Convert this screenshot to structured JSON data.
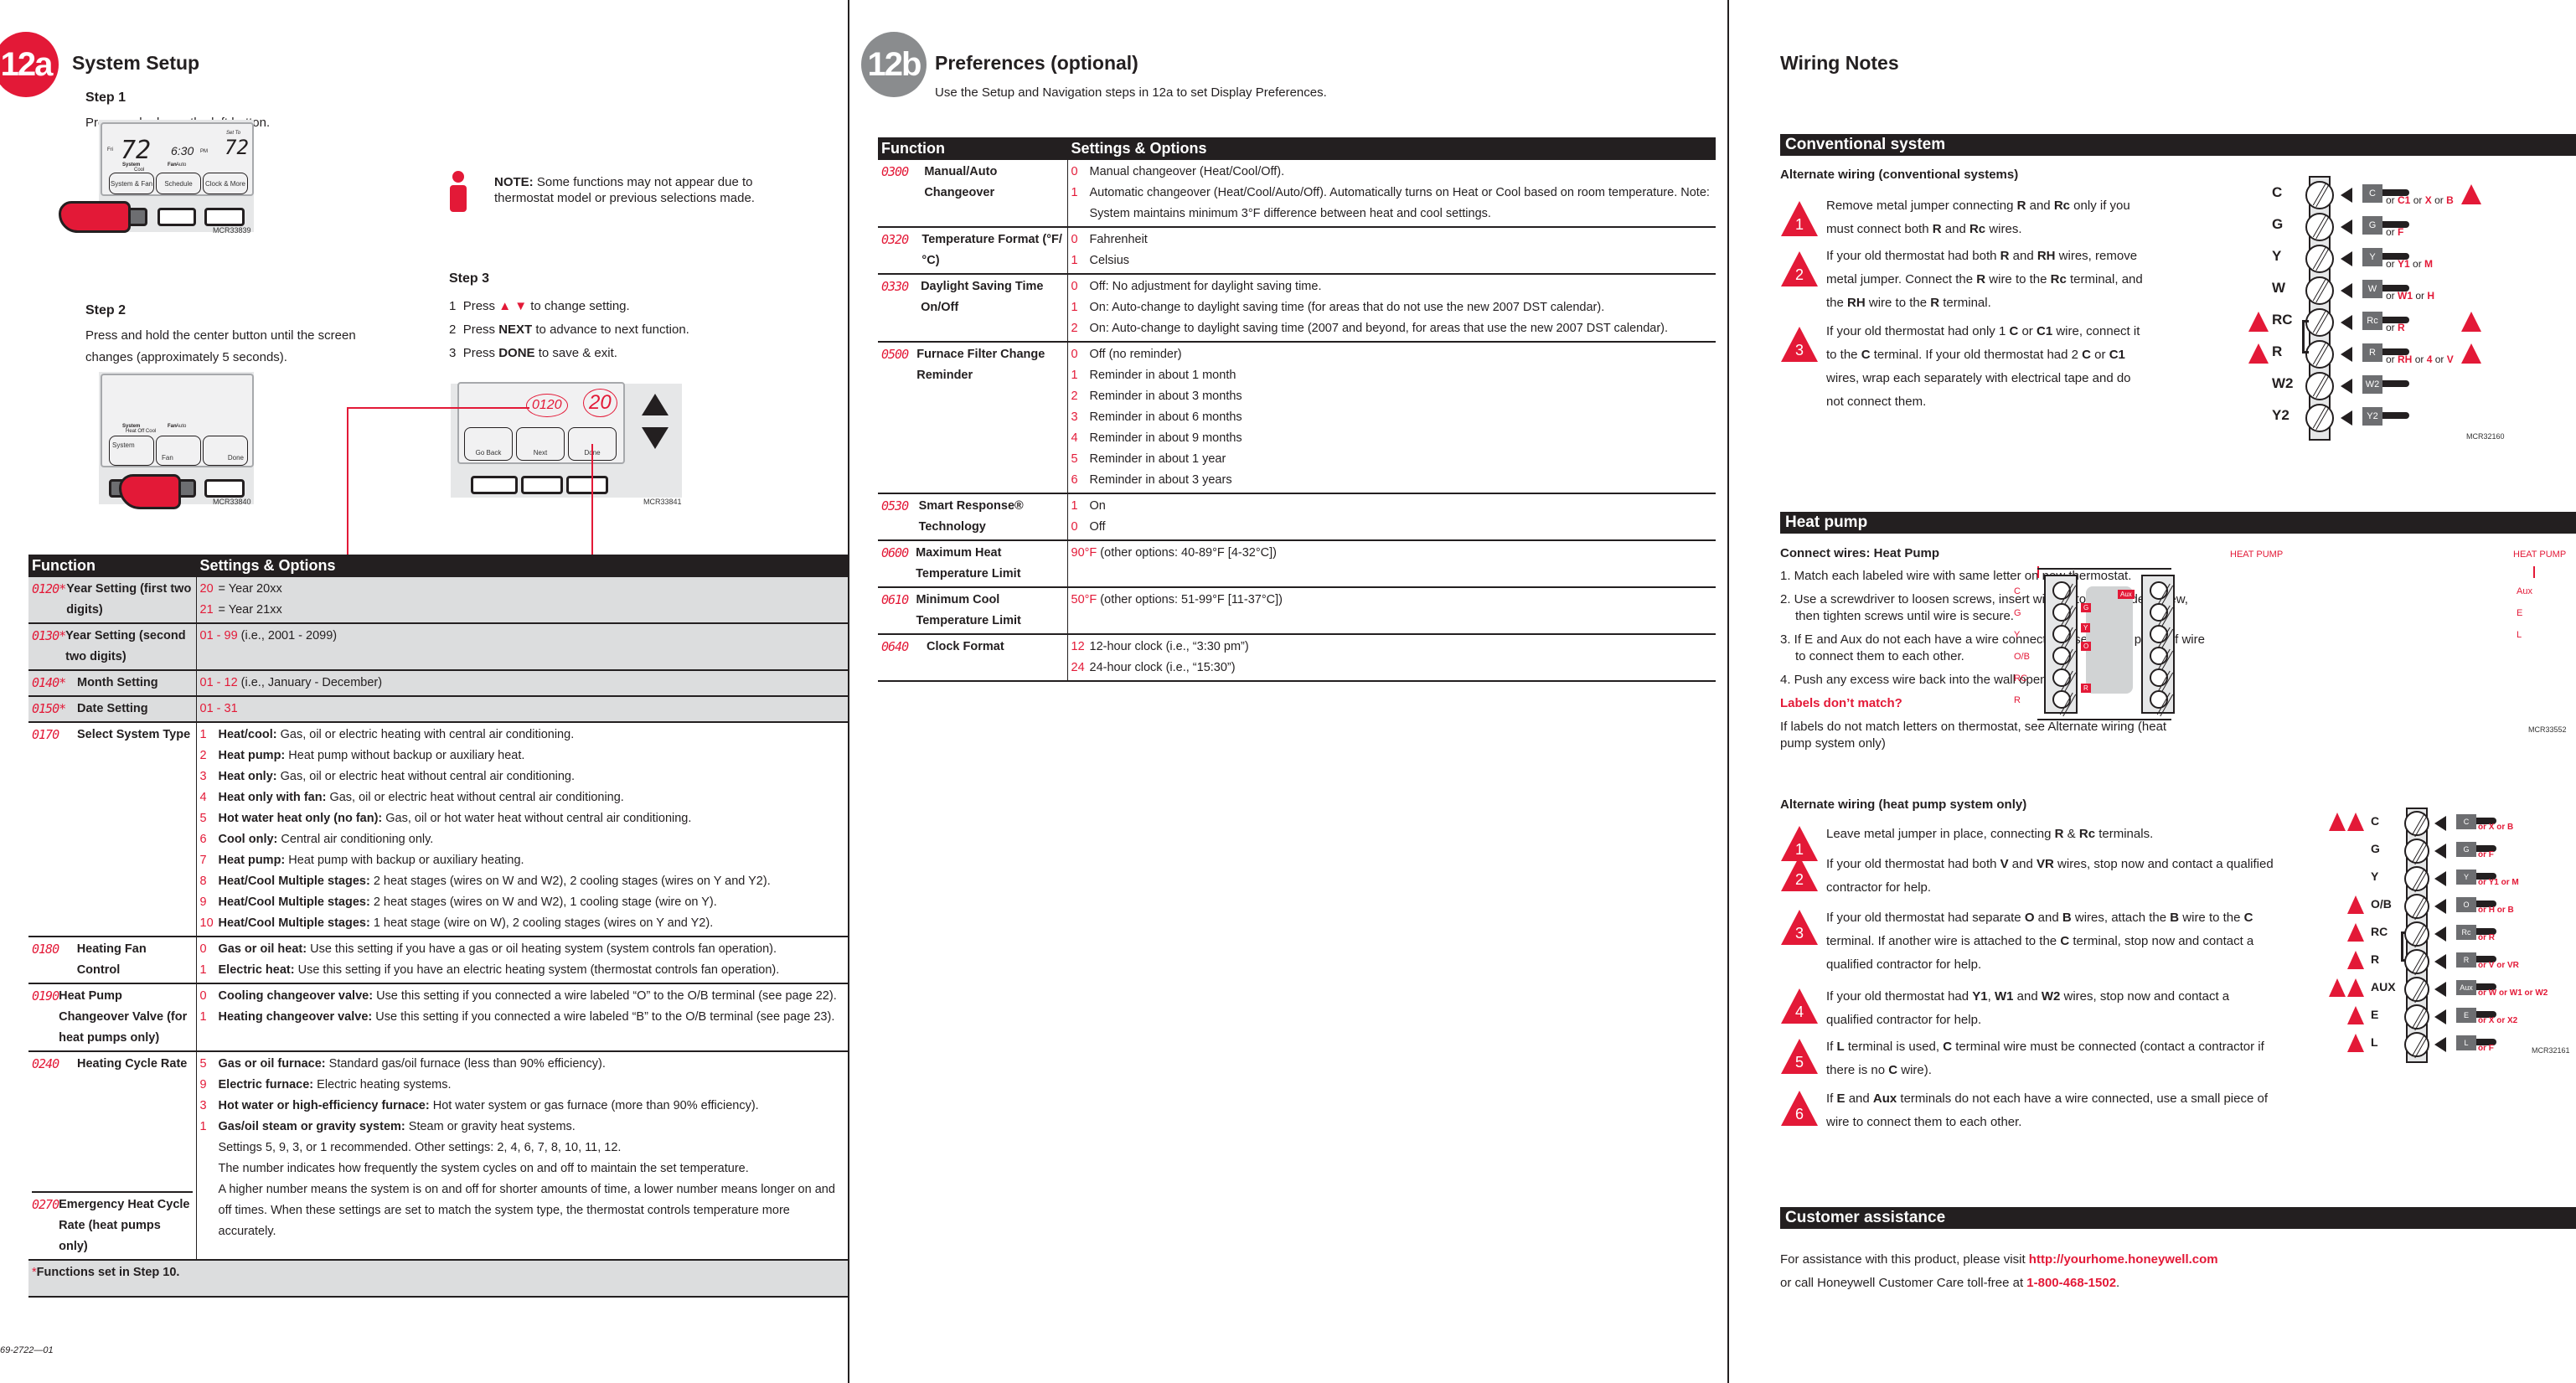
{
  "page_12a": {
    "badge": "12a",
    "title": "System Setup",
    "step1": {
      "heading": "Step 1",
      "text": "Press and release the left button."
    },
    "fig1": {
      "day": "Fri",
      "indoor_temp": "72",
      "time": "6:30",
      "ampm": "PM",
      "set_to_label": "Set To",
      "set_temp": "72",
      "system_label": "System",
      "system_mode": "Cool",
      "fan_label": "Fan",
      "fan_mode": "Auto",
      "buttons": [
        "System & Fan",
        "Schedule",
        "Clock & More"
      ],
      "code": "MCR33839"
    },
    "step2": {
      "heading": "Step 2",
      "text": "Press and hold the center button until the screen changes (approximately 5 seconds)."
    },
    "fig2": {
      "system_label": "System",
      "system_modes": "Heat Off Cool",
      "fan_label": "Fan",
      "fan_mode": "Auto",
      "buttons": [
        "System",
        "Fan",
        "Done"
      ],
      "code": "MCR33840"
    },
    "note": {
      "label": "NOTE:",
      "text": "Some functions may not appear due to thermostat model or previous selections made."
    },
    "step3": {
      "heading": "Step 3",
      "items": [
        {
          "num": "1",
          "pre": "Press",
          "bold": "▲ ▼",
          "post": "to change setting."
        },
        {
          "num": "2",
          "pre": "Press",
          "bold": "NEXT",
          "post": "to advance to next function."
        },
        {
          "num": "3",
          "pre": "Press",
          "bold": "DONE",
          "post": "to save & exit."
        }
      ]
    },
    "fig3": {
      "function_code": "0120",
      "value": "20",
      "buttons": [
        "Go Back",
        "Next",
        "Done"
      ],
      "code": "MCR33841"
    },
    "table": {
      "headers": [
        "Function",
        "Settings & Options"
      ],
      "rows": [
        {
          "code": "0120*",
          "name": "Year Setting (first two digits)",
          "grey": true,
          "options": [
            {
              "n": "20",
              "t": "= Year 20xx"
            },
            {
              "n": "21",
              "t": "= Year 21xx"
            }
          ]
        },
        {
          "code": "0130*",
          "name": "Year Setting (second two digits)",
          "grey": true,
          "options": [
            {
              "n": "01 - 99",
              "t": "(i.e., 2001 - 2099)"
            }
          ]
        },
        {
          "code": "0140*",
          "name": "Month Setting",
          "grey": true,
          "options": [
            {
              "n": "01 - 12",
              "t": "(i.e., January - December)"
            }
          ]
        },
        {
          "code": "0150*",
          "name": "Date Setting",
          "grey": true,
          "options": [
            {
              "n": "01 - 31",
              "t": ""
            }
          ]
        },
        {
          "code": "0170",
          "name": "Select System Type",
          "grey": false,
          "options": [
            {
              "n": "1",
              "b": "Heat/cool:",
              "t": "Gas, oil or electric heating with central air conditioning."
            },
            {
              "n": "2",
              "b": "Heat pump:",
              "t": "Heat pump without backup or auxiliary heat."
            },
            {
              "n": "3",
              "b": "Heat only:",
              "t": "Gas, oil or electric heat without central air conditioning."
            },
            {
              "n": "4",
              "b": "Heat only with fan:",
              "t": "Gas, oil or electric heat without central air conditioning."
            },
            {
              "n": "5",
              "b": "Hot water heat only (no fan):",
              "t": "Gas, oil or hot water heat without central air conditioning."
            },
            {
              "n": "6",
              "b": "Cool only:",
              "t": "Central air conditioning only."
            },
            {
              "n": "7",
              "b": "Heat pump:",
              "t": "Heat pump with backup or auxiliary heating."
            },
            {
              "n": "8",
              "b": "Heat/Cool Multiple stages:",
              "t": "2 heat stages (wires on W and W2), 2 cooling stages (wires on Y and Y2)."
            },
            {
              "n": "9",
              "b": "Heat/Cool Multiple stages:",
              "t": "2 heat stages (wires on W and W2), 1 cooling stage (wire on Y)."
            },
            {
              "n": "10",
              "b": "Heat/Cool Multiple stages:",
              "t": "1 heat stage (wire on W), 2 cooling stages (wires on Y and Y2)."
            }
          ]
        },
        {
          "code": "0180",
          "name": "Heating Fan Control",
          "grey": false,
          "options": [
            {
              "n": "0",
              "b": "Gas or oil heat:",
              "t": "Use this setting if you have a gas or oil heating system (system controls fan operation)."
            },
            {
              "n": "1",
              "b": "Electric heat:",
              "t": "Use this setting if you have an electric heating system (thermostat controls fan operation)."
            }
          ]
        },
        {
          "code": "0190",
          "name": "Heat Pump Changeover Valve (for heat pumps only)",
          "grey": false,
          "options": [
            {
              "n": "0",
              "b": "Cooling changeover valve:",
              "t": "Use this setting if you connected a wire labeled “O” to the O/B terminal (see page 22)."
            },
            {
              "n": "1",
              "b": "Heating changeover valve:",
              "t": "Use this setting if you connected a wire labeled “B” to the O/B terminal (see page 23)."
            }
          ]
        }
      ],
      "cycle": {
        "codes": [
          {
            "code": "0240",
            "name": "Heating Cycle Rate"
          },
          {
            "code": "0270",
            "name": "Emergency Heat Cycle Rate (heat pumps only)"
          }
        ],
        "options": [
          {
            "n": "5",
            "b": "Gas or oil furnace:",
            "t": "Standard gas/oil furnace (less than 90% efficiency)."
          },
          {
            "n": "9",
            "b": "Electric furnace:",
            "t": "Electric heating systems."
          },
          {
            "n": "3",
            "b": "Hot water or high-efficiency furnace:",
            "t": "Hot water system or gas furnace (more than 90% efficiency)."
          },
          {
            "n": "1",
            "b": "Gas/oil steam or gravity system:",
            "t": "Steam or gravity heat systems."
          }
        ],
        "notes": [
          "Settings 5, 9, 3, or 1 recommended. Other settings: 2, 4, 6, 7, 8, 10, 11, 12.",
          "The number indicates how frequently the system cycles on and off to maintain the set temperature.",
          "A higher number means the system is on and off for shorter amounts of time, a lower number means longer on and off times. When these settings are set to match the system type, the thermostat controls temperature more accurately."
        ]
      },
      "footnote_star": "*",
      "footnote": "Functions set in Step 10."
    },
    "doc_number": "69-2722—01"
  },
  "page_12b": {
    "badge": "12b",
    "title": "Preferences (optional)",
    "intro": "Use the Setup and Navigation steps in 12a to set Display Preferences.",
    "table": {
      "headers": [
        "Function",
        "Settings & Options"
      ],
      "rows": [
        {
          "code": "0300",
          "name": "Manual/Auto Changeover",
          "options": [
            {
              "n": "0",
              "t": "Manual changeover (Heat/Cool/Off)."
            },
            {
              "n": "1",
              "t": "Automatic changeover (Heat/Cool/Auto/Off). Automatically turns on Heat or Cool based on room temperature. Note: System maintains minimum 3°F difference between heat and cool settings."
            }
          ]
        },
        {
          "code": "0320",
          "name": "Temperature Format (°F/°C)",
          "options": [
            {
              "n": "0",
              "t": "Fahrenheit"
            },
            {
              "n": "1",
              "t": "Celsius"
            }
          ]
        },
        {
          "code": "0330",
          "name": "Daylight Saving Time On/Off",
          "options": [
            {
              "n": "0",
              "t": "Off: No adjustment for daylight saving time."
            },
            {
              "n": "1",
              "t": "On: Auto-change to daylight saving time (for areas that do not use the new 2007 DST calendar)."
            },
            {
              "n": "2",
              "t": "On: Auto-change to daylight saving time (2007 and beyond, for areas that use the new 2007 DST calendar)."
            }
          ]
        },
        {
          "code": "0500",
          "name": "Furnace Filter Change Reminder",
          "options": [
            {
              "n": "0",
              "t": "Off (no reminder)"
            },
            {
              "n": "1",
              "t": "Reminder in about 1 month"
            },
            {
              "n": "2",
              "t": "Reminder in about 3 months"
            },
            {
              "n": "3",
              "t": "Reminder in about 6 months"
            },
            {
              "n": "4",
              "t": "Reminder in about 9 months"
            },
            {
              "n": "5",
              "t": "Reminder in about 1 year"
            },
            {
              "n": "6",
              "t": "Reminder in about 3 years"
            }
          ]
        },
        {
          "code": "0530",
          "name": "Smart Response® Technology",
          "options": [
            {
              "n": "1",
              "t": "On"
            },
            {
              "n": "0",
              "t": "Off"
            }
          ]
        },
        {
          "code": "0600",
          "name": "Maximum Heat Temperature Limit",
          "options": [
            {
              "n": "90°F",
              "t": "(other options: 40-89°F [4-32°C])"
            }
          ]
        },
        {
          "code": "0610",
          "name": "Minimum Cool Temperature Limit",
          "options": [
            {
              "n": "50°F",
              "t": "(other options: 51-99°F [11-37°C])"
            }
          ]
        },
        {
          "code": "0640",
          "name": "Clock Format",
          "options": [
            {
              "n": "12",
              "t": "12-hour clock (i.e., “3:30 pm”)"
            },
            {
              "n": "24",
              "t": "24-hour clock (i.e., “15:30”)"
            }
          ]
        }
      ]
    }
  },
  "wiring": {
    "title": "Wiring Notes",
    "conventional": {
      "bar": "Conventional system",
      "subtitle": "Alternate wiring (conventional systems)",
      "notes": [
        {
          "num": "1",
          "text": "Remove metal jumper connecting R and Rc only if you must connect both R and Rc wires."
        },
        {
          "num": "2",
          "text": "If your old thermostat had both R and RH wires, remove metal jumper. Connect the R wire to the Rc terminal, and the RH wire to the R terminal."
        },
        {
          "num": "3",
          "text": "If your old thermostat had only 1 C or C1 wire, connect it to the C terminal. If your old thermostat had 2 C or C1 wires, wrap each separately with electrical tape and do not connect them."
        }
      ],
      "terminals": [
        {
          "label": "C",
          "tag": "C",
          "alt": "or C1 or X or B",
          "warn_right": "3"
        },
        {
          "label": "G",
          "tag": "G",
          "alt": "or F"
        },
        {
          "label": "Y",
          "tag": "Y",
          "alt": "or Y1 or M"
        },
        {
          "label": "W",
          "tag": "W",
          "alt": "or W1 or H"
        },
        {
          "label": "RC",
          "tag": "Rc",
          "alt": "or R",
          "warn_left": "1",
          "warn_right": "2"
        },
        {
          "label": "R",
          "tag": "R",
          "alt": "or RH or 4 or V",
          "warn_left": "1",
          "warn_right": "2"
        },
        {
          "label": "W2",
          "tag": "W2",
          "alt": ""
        },
        {
          "label": "Y2",
          "tag": "Y2",
          "alt": ""
        }
      ],
      "code": "MCR32160"
    },
    "heat_pump": {
      "bar": "Heat pump",
      "subtitle": "Connect wires: Heat Pump",
      "steps": [
        "1. Match each labeled wire with same letter on new thermostat.",
        "2. Use a screwdriver to loosen screws, insert wires into hole under screw, then tighten screws until wire is secure.",
        "3. If E and Aux do not each have a wire connected, use a small piece of wire to connect them to each other.",
        "4. Push any excess wire back into the wall opening."
      ],
      "labels_heading": "Labels don’t match?",
      "labels_text": "If labels do not match letters on thermostat, see Alternate wiring (heat pump system only)",
      "fig": {
        "left_title": "HEAT PUMP",
        "right_title": "HEAT PUMP",
        "left_terminals": [
          "C",
          "G",
          "Y",
          "O/B",
          "RC",
          "R"
        ],
        "right_terminals": [
          "Aux",
          "E",
          "L"
        ],
        "wire_tags": [
          "G",
          "Y",
          "O",
          "R",
          "Aux"
        ],
        "code": "MCR33552"
      }
    },
    "alt_heat_pump": {
      "subtitle": "Alternate wiring (heat pump system only)",
      "notes": [
        {
          "num": "1",
          "text": "Leave metal jumper in place, connecting R & Rc terminals."
        },
        {
          "num": "2",
          "text": "If your old thermostat had both V and VR wires, stop now and contact a qualified contractor for help."
        },
        {
          "num": "3",
          "text": "If your old thermostat had separate O and B wires, attach the B wire to the C terminal. If another wire is attached to the C terminal, stop now and contact a qualified contractor for help."
        },
        {
          "num": "4",
          "text": "If your old thermostat had Y1, W1 and W2 wires, stop now and contact a qualified contractor for help."
        },
        {
          "num": "5",
          "text": "If L terminal is used, C terminal wire must be connected (contact a contractor if there is no C wire)."
        },
        {
          "num": "6",
          "text": "If E and Aux terminals do not each have a wire connected, use a small piece of wire to connect them to each other."
        }
      ],
      "terminals": [
        {
          "label": "C",
          "tag": "C",
          "alt": "or X or B",
          "warn": [
            "3",
            "5"
          ]
        },
        {
          "label": "G",
          "tag": "G",
          "alt": "or F",
          "warn": []
        },
        {
          "label": "Y",
          "tag": "Y",
          "alt": "or Y1 or M",
          "warn": []
        },
        {
          "label": "O/B",
          "tag": "O",
          "alt": "or H or B",
          "warn": [
            "3"
          ]
        },
        {
          "label": "RC",
          "tag": "Rc",
          "alt": "or R",
          "warn": [
            "1"
          ]
        },
        {
          "label": "R",
          "tag": "R",
          "alt": "or V or VR",
          "warn": [
            "2"
          ]
        },
        {
          "label": "AUX",
          "tag": "Aux",
          "alt": "or W or W1 or W2",
          "warn": [
            "4",
            "6"
          ]
        },
        {
          "label": "E",
          "tag": "E",
          "alt": "or X or X2",
          "warn": [
            "6"
          ]
        },
        {
          "label": "L",
          "tag": "L",
          "alt": "or F",
          "warn": [
            "5"
          ]
        }
      ],
      "code": "MCR32161"
    },
    "customer": {
      "bar": "Customer assistance",
      "line1_pre": "For assistance with this product, please visit",
      "url": "http://yourhome.honeywell.com",
      "line2_pre": "or call Honeywell Customer Care toll-free at",
      "phone": "1-800-468-1502",
      "line2_post": "."
    }
  },
  "colors": {
    "accent": "#e31937",
    "dark": "#231f20",
    "grey_row": "#dcddde",
    "badge_grey": "#8a8c8e"
  }
}
